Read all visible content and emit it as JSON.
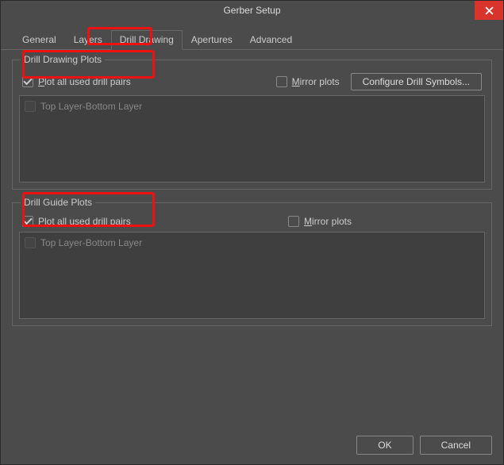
{
  "title": "Gerber Setup",
  "tabs": {
    "general": "General",
    "layers": "Layers",
    "drill_drawing": "Drill Drawing",
    "apertures": "Apertures",
    "advanced": "Advanced"
  },
  "group1": {
    "legend": "Drill Drawing Plots",
    "plot_all_label": "Plot all used drill pairs",
    "mirror_label": "Mirror plots",
    "config_btn": "Configure Drill Symbols...",
    "item0": "Top Layer-Bottom Layer"
  },
  "group2": {
    "legend": "Drill Guide Plots",
    "plot_all_label": "Plot all used drill pairs",
    "mirror_label": "Mirror plots",
    "item0": "Top Layer-Bottom Layer"
  },
  "footer": {
    "ok": "OK",
    "cancel": "Cancel"
  }
}
